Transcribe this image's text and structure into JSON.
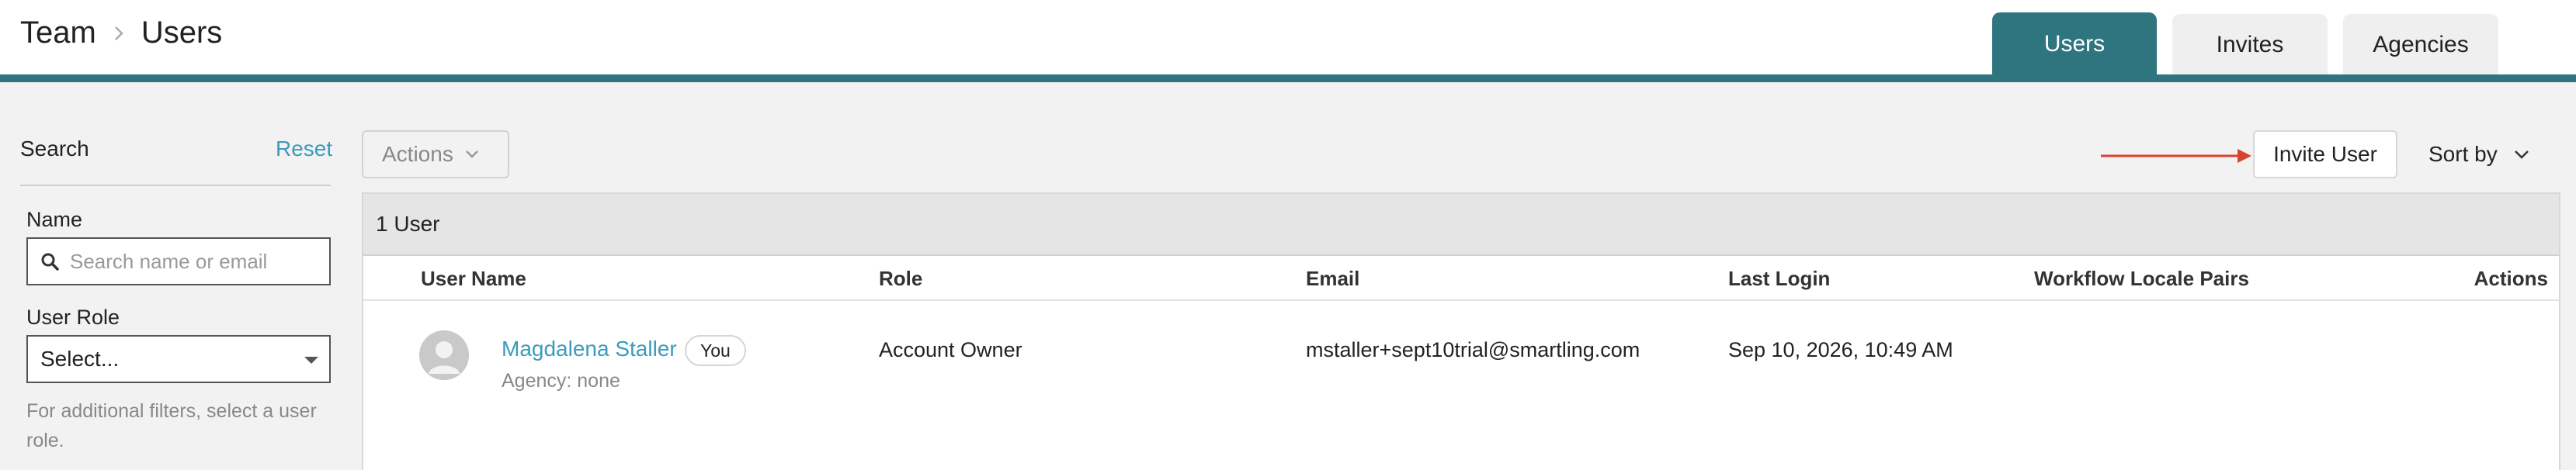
{
  "breadcrumb": {
    "root": "Team",
    "current": "Users"
  },
  "tabs": [
    {
      "label": "Users",
      "active": true
    },
    {
      "label": "Invites",
      "active": false
    },
    {
      "label": "Agencies",
      "active": false
    }
  ],
  "sidebar": {
    "title": "Search",
    "reset_label": "Reset",
    "name_label": "Name",
    "search_placeholder": "Search name or email",
    "role_label": "User Role",
    "role_select_value": "Select...",
    "help_text": "For additional filters, select a user role."
  },
  "toolbar": {
    "actions_label": "Actions",
    "invite_label": "Invite User",
    "sort_label": "Sort by"
  },
  "table": {
    "count_label": "1 User",
    "columns": [
      "User Name",
      "Role",
      "Email",
      "Last Login",
      "Workflow Locale Pairs",
      "Actions"
    ],
    "rows": [
      {
        "name": "Magdalena Staller",
        "badge": "You",
        "agency": "Agency: none",
        "role": "Account Owner",
        "email": "mstaller+sept10trial@smartling.com",
        "last_login": "Sep 10, 2026, 10:49 AM",
        "locale_pairs": "",
        "actions": ""
      }
    ]
  },
  "colors": {
    "accent": "#2f7580",
    "link": "#3a9bbd",
    "annotation_arrow": "#d9432f"
  },
  "icons": {
    "breadcrumb_separator": "chevron-right-icon",
    "search": "search-icon",
    "dropdown": "chevron-down-icon",
    "avatar": "default-user-avatar-icon",
    "annotation": "red-arrow-icon"
  }
}
